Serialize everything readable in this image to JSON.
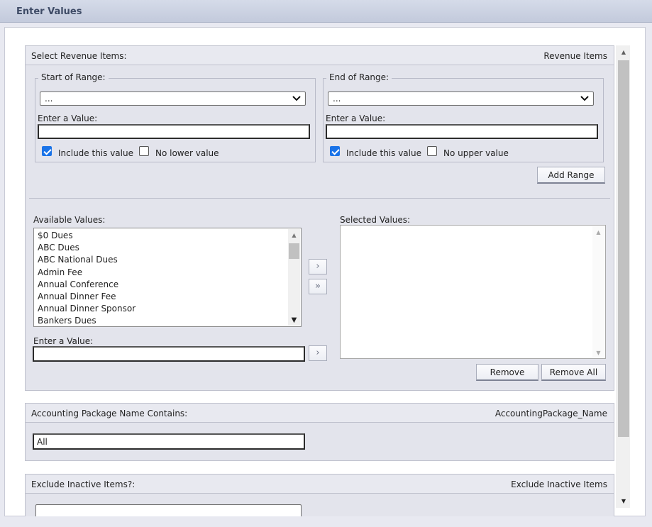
{
  "window": {
    "title": "Enter Values"
  },
  "revenue": {
    "header_label": "Select Revenue Items:",
    "param_name": "Revenue Items",
    "start": {
      "legend": "Start of Range:",
      "select_value": "...",
      "value_label": "Enter a Value:",
      "value": "",
      "include_label": "Include this value",
      "include_checked": true,
      "bound_label": "No lower value",
      "bound_checked": false
    },
    "end": {
      "legend": "End of Range:",
      "select_value": "...",
      "value_label": "Enter a Value:",
      "value": "",
      "include_label": "Include this value",
      "include_checked": true,
      "bound_label": "No upper value",
      "bound_checked": false
    },
    "add_range_label": "Add Range",
    "available_label": "Available Values:",
    "available_items": [
      "$0 Dues",
      "ABC Dues",
      "ABC National Dues",
      "Admin Fee",
      "Annual Conference",
      "Annual Dinner Fee",
      "Annual Dinner Sponsor",
      "Bankers Dues"
    ],
    "selected_label": "Selected Values:",
    "selected_items": [],
    "move_one_symbol": "›",
    "move_all_symbol": "»",
    "enter_value_label": "Enter a Value:",
    "enter_value": "",
    "remove_label": "Remove",
    "remove_all_label": "Remove All"
  },
  "accounting": {
    "header_label": "Accounting Package Name Contains:",
    "param_name": "AccountingPackage_Name",
    "value": "All"
  },
  "inactive": {
    "header_label": "Exclude Inactive Items?:",
    "param_name": "Exclude Inactive Items"
  },
  "colors": {
    "accent": "#1a73e8",
    "title_text": "#3e4b66",
    "panel_bg": "#e3e4ec"
  }
}
